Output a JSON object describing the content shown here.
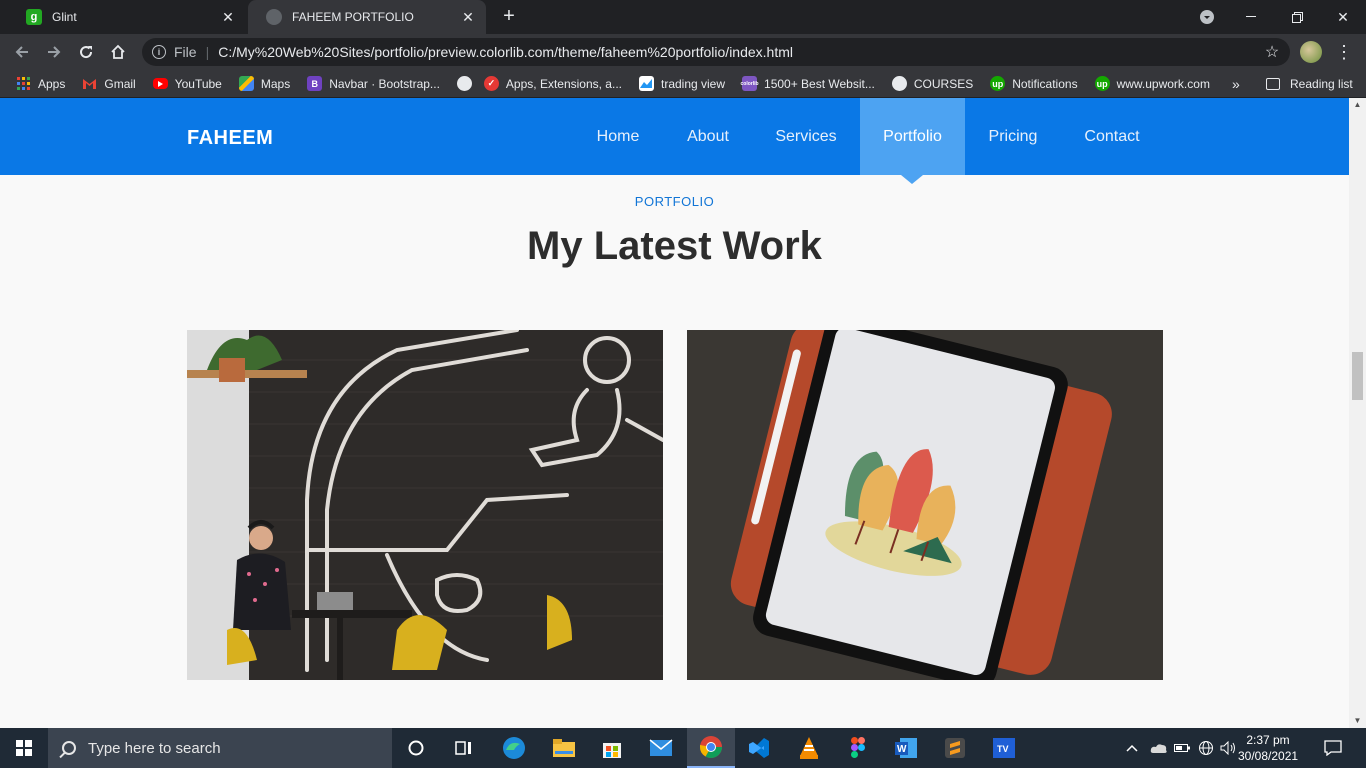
{
  "browser": {
    "tabs": [
      {
        "title": "Glint",
        "favicon_letter": "g",
        "favicon_color": "#22a822",
        "active": false
      },
      {
        "title": "FAHEEM PORTFOLIO",
        "favicon_letter": "",
        "favicon_color": "#5f6368",
        "active": true
      }
    ],
    "new_tab_glyph": "+",
    "address": {
      "scheme_label": "File",
      "url": "C:/My%20Web%20Sites/portfolio/preview.colorlib.com/theme/faheem%20portfolio/index.html"
    },
    "bookmarks": [
      {
        "label": "Apps",
        "icon": "apps-grid-icon",
        "color": "#ea4335"
      },
      {
        "label": "Gmail",
        "icon": "gmail-icon",
        "color": "#ea4335"
      },
      {
        "label": "YouTube",
        "icon": "youtube-icon",
        "color": "#ff0000"
      },
      {
        "label": "Maps",
        "icon": "maps-icon",
        "color": "#34a853"
      },
      {
        "label": "Navbar · Bootstrap...",
        "icon": "bootstrap-icon",
        "color": "#6f42c1"
      },
      {
        "label": "",
        "icon": "globe-icon",
        "color": "#e8eaed"
      },
      {
        "label": "Apps, Extensions, a...",
        "icon": "extensions-icon",
        "color": "#e53935"
      },
      {
        "label": "trading view",
        "icon": "tradingview-icon",
        "color": "#2196f3"
      },
      {
        "label": "1500+ Best Websit...",
        "icon": "colorlib-icon",
        "color": "#7e57c2"
      },
      {
        "label": "COURSES",
        "icon": "globe-icon",
        "color": "#e8eaed"
      },
      {
        "label": "Notifications",
        "icon": "upwork-icon",
        "color": "#14a800"
      },
      {
        "label": "www.upwork.com",
        "icon": "upwork-icon",
        "color": "#14a800"
      }
    ],
    "bookmarks_more": "»",
    "reading_list": "Reading list"
  },
  "site": {
    "brand": "FAHEEM",
    "nav": [
      {
        "label": "Home",
        "active": false
      },
      {
        "label": "About",
        "active": false
      },
      {
        "label": "Services",
        "active": false
      },
      {
        "label": "Portfolio",
        "active": true
      },
      {
        "label": "Pricing",
        "active": false
      },
      {
        "label": "Contact",
        "active": false
      }
    ],
    "section_kicker": "PORTFOLIO",
    "section_title": "My Latest Work",
    "works": [
      {
        "name": "cafe-mural-work"
      },
      {
        "name": "tablet-illustration-work"
      }
    ],
    "colors": {
      "nav_bg": "#0a78e6",
      "nav_active": "#4da3f2",
      "kicker": "#1175d6"
    }
  },
  "taskbar": {
    "search_placeholder": "Type here to search",
    "time": "2:37 pm",
    "date": "30/08/2021"
  }
}
